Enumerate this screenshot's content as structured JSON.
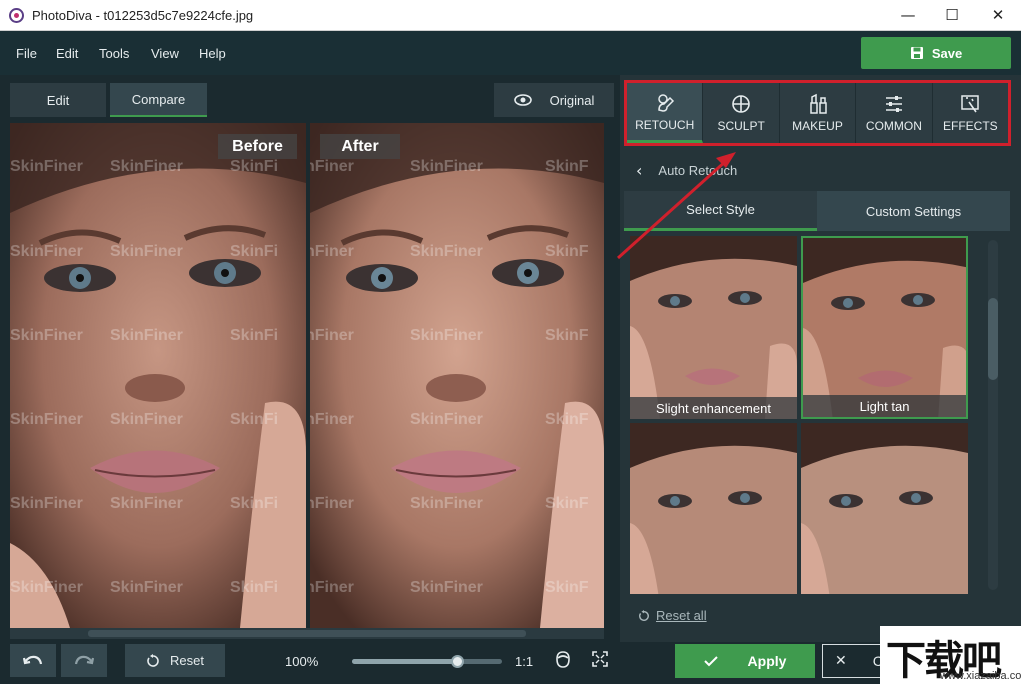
{
  "window": {
    "title": "PhotoDiva - t012253d5c7e9224cfe.jpg",
    "minimize": "—",
    "maximize": "☐",
    "close": "✕"
  },
  "menu": [
    "File",
    "Edit",
    "Tools",
    "View",
    "Help"
  ],
  "save_label": "Save",
  "view_tabs": {
    "edit": "Edit",
    "compare": "Compare",
    "original": "Original"
  },
  "compare": {
    "before_label": "Before",
    "after_label": "After",
    "watermark": "SkinFiner"
  },
  "tool_tabs": [
    {
      "label": "RETOUCH",
      "icon": "retouch-brush-icon",
      "active": true
    },
    {
      "label": "SCULPT",
      "icon": "sculpt-crosshair-icon",
      "active": false
    },
    {
      "label": "MAKEUP",
      "icon": "makeup-lipstick-icon",
      "active": false
    },
    {
      "label": "COMMON",
      "icon": "sliders-icon",
      "active": false
    },
    {
      "label": "EFFECTS",
      "icon": "effects-wand-icon",
      "active": false
    }
  ],
  "breadcrumb": {
    "title": "Auto Retouch"
  },
  "style_tabs": {
    "select_style": "Select Style",
    "custom_settings": "Custom Settings"
  },
  "presets": [
    {
      "label": "Slight enhancement"
    },
    {
      "label": "Light tan"
    },
    {
      "label": ""
    },
    {
      "label": ""
    }
  ],
  "reset_all": "Reset all",
  "bottom": {
    "reset": "Reset",
    "zoom": "100%",
    "ratio": "1:1",
    "zoom_level": 0.7
  },
  "apply_label": "Apply",
  "cancel_label": "Cancel",
  "site_watermark": {
    "main": "下载吧",
    "sub": "www.xiazaiba.com"
  },
  "colors": {
    "accent_green": "#3f9b4e",
    "highlight_red": "#d0202c",
    "panel": "#253439"
  }
}
